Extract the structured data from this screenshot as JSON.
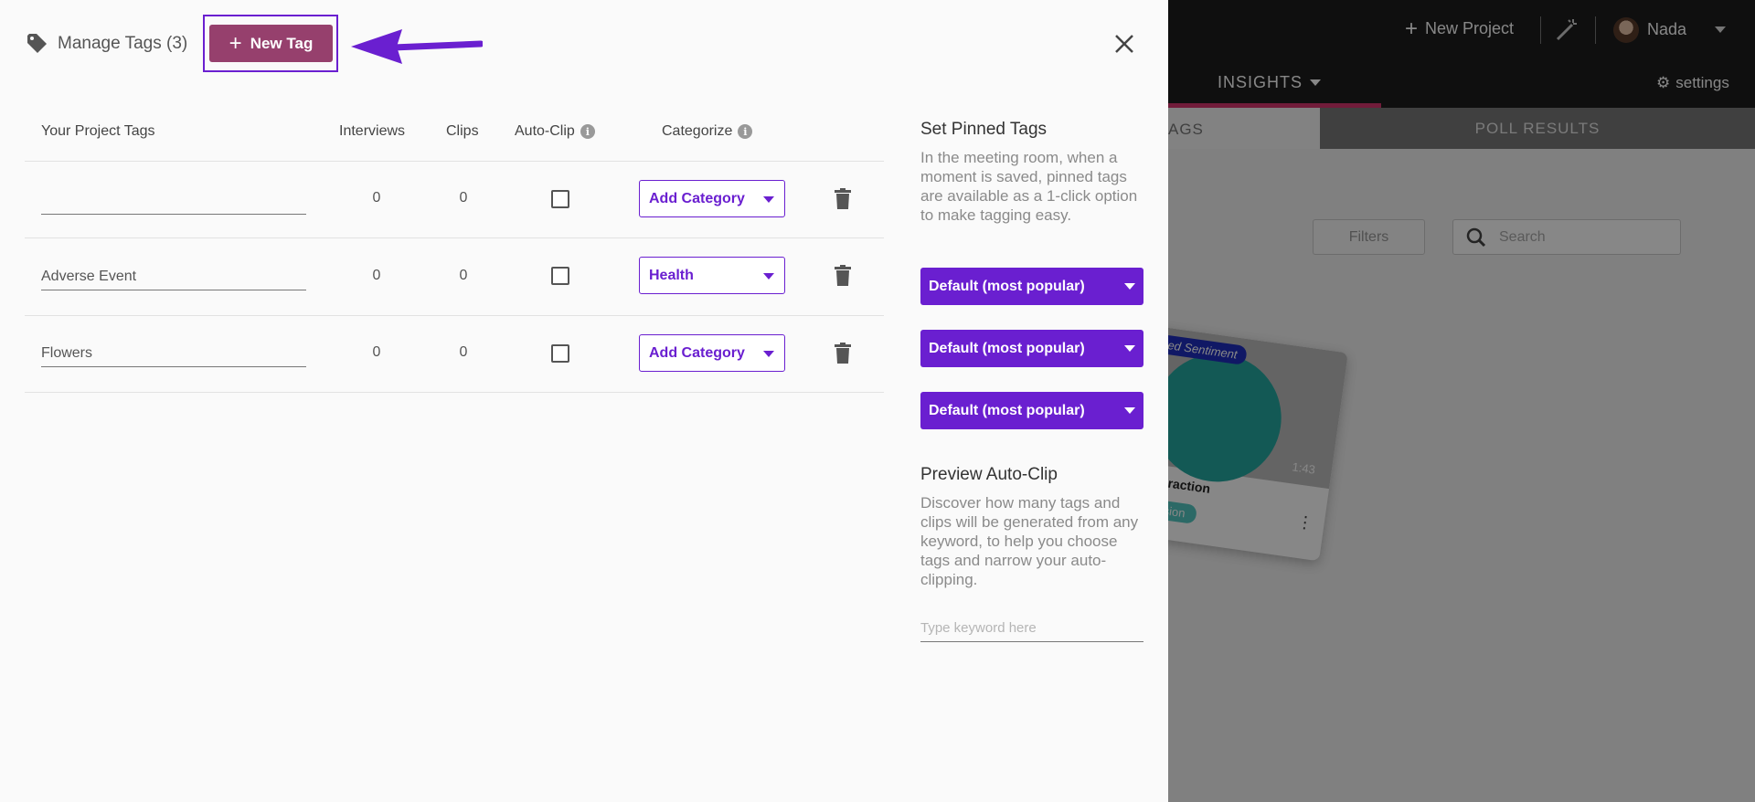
{
  "background": {
    "new_project_label": "New Project",
    "user_name": "Nada",
    "nav_insights": "INSIGHTS",
    "settings_label": "settings",
    "tab_tags": "AGS",
    "tab_poll_results": "POLL RESULTS",
    "filters_label": "Filters",
    "search_placeholder": "Search",
    "card": {
      "sentiment": "ixed Sentiment",
      "duration": "1:43",
      "title": "e Interaction",
      "badge": "decision"
    }
  },
  "panel": {
    "title": "Manage Tags (3)",
    "new_tag_label": "New Tag",
    "columns": {
      "project_tags": "Your Project Tags",
      "interviews": "Interviews",
      "clips": "Clips",
      "auto_clip": "Auto-Clip",
      "categorize": "Categorize"
    },
    "rows": [
      {
        "name": "",
        "interviews": "0",
        "clips": "0",
        "auto_clip": false,
        "category": "Add Category"
      },
      {
        "name": "Adverse Event",
        "interviews": "0",
        "clips": "0",
        "auto_clip": false,
        "category": "Health"
      },
      {
        "name": "Flowers",
        "interviews": "0",
        "clips": "0",
        "auto_clip": false,
        "category": "Add Category"
      }
    ],
    "pinned": {
      "title": "Set Pinned Tags",
      "description": "In the meeting room, when a moment is saved, pinned tags are available as a 1-click option to make tagging easy.",
      "options": [
        "Default (most popular)",
        "Default (most popular)",
        "Default (most popular)"
      ]
    },
    "preview": {
      "title": "Preview Auto-Clip",
      "description": "Discover how many tags and clips will be generated from any keyword, to help you choose tags and narrow your auto-clipping.",
      "keyword_placeholder": "Type keyword here"
    }
  },
  "colors": {
    "accent_purple": "#6a1fd0",
    "new_tag_button": "#96406d",
    "insights_underline": "#d6356f"
  }
}
